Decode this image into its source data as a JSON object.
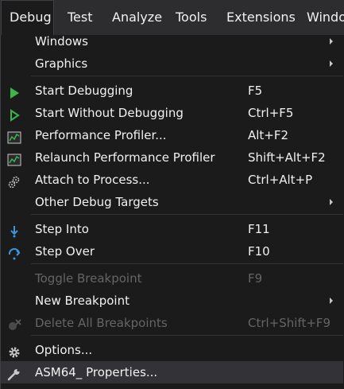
{
  "menubar": {
    "items": [
      {
        "label": "Debug",
        "active": true
      },
      {
        "label": "Test"
      },
      {
        "label": "Analyze"
      },
      {
        "label": "Tools"
      },
      {
        "label": "Extensions"
      },
      {
        "label": "Windo"
      }
    ]
  },
  "menu": {
    "items": [
      {
        "label": "Windows",
        "submenu": true
      },
      {
        "label": "Graphics",
        "submenu": true
      },
      {
        "label": "Start Debugging",
        "shortcut": "F5",
        "icon": "play-icon"
      },
      {
        "label": "Start Without Debugging",
        "shortcut": "Ctrl+F5",
        "icon": "play-outline-icon"
      },
      {
        "label": "Performance Profiler...",
        "shortcut": "Alt+F2",
        "icon": "performance-chart-icon"
      },
      {
        "label": "Relaunch Performance Profiler",
        "shortcut": "Shift+Alt+F2",
        "icon": "performance-chart-icon"
      },
      {
        "label": "Attach to Process...",
        "shortcut": "Ctrl+Alt+P",
        "icon": "attach-gears-icon"
      },
      {
        "label": "Other Debug Targets",
        "submenu": true
      },
      {
        "label": "Step Into",
        "shortcut": "F11",
        "icon": "step-into-icon"
      },
      {
        "label": "Step Over",
        "shortcut": "F10",
        "icon": "step-over-icon"
      },
      {
        "label": "Toggle Breakpoint",
        "shortcut": "F9",
        "disabled": true
      },
      {
        "label": "New Breakpoint",
        "submenu": true
      },
      {
        "label": "Delete All Breakpoints",
        "shortcut": "Ctrl+Shift+F9",
        "disabled": true,
        "icon": "delete-breakpoints-icon"
      },
      {
        "label": "Options...",
        "icon": "gear-icon"
      },
      {
        "label": "ASM64_ Properties...",
        "icon": "wrench-icon",
        "hover": true
      }
    ]
  },
  "colors": {
    "background": "#1b1b1c",
    "menubar": "#2d2d30",
    "text": "#f1f1f1",
    "disabled_text": "#656565",
    "play_green": "#3bb44a",
    "step_blue": "#3a96dd",
    "hover": "#333337"
  }
}
